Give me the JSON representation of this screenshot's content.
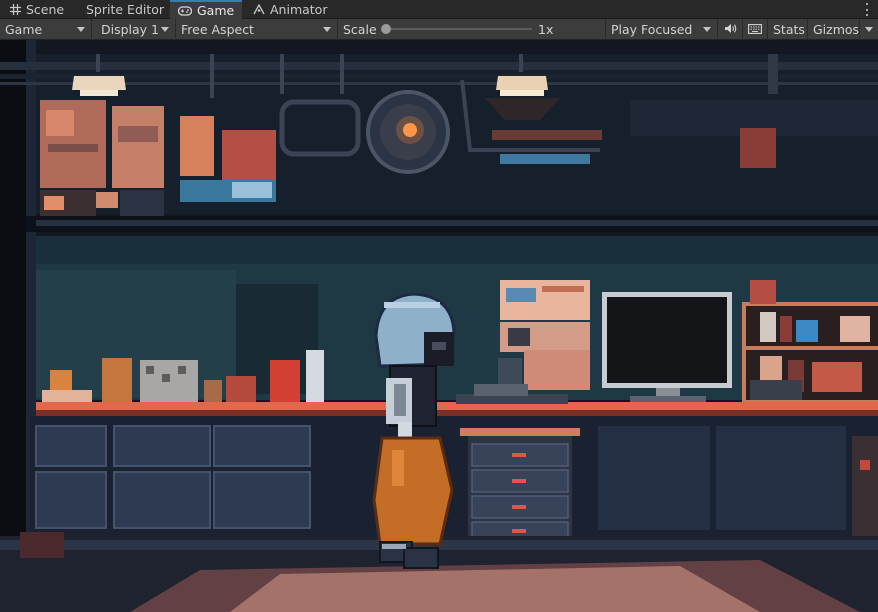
{
  "tabs": [
    {
      "label": "Scene",
      "icon": "grid-icon"
    },
    {
      "label": "Sprite Editor",
      "icon": ""
    },
    {
      "label": "Game",
      "icon": "gamepad-icon",
      "active": true
    },
    {
      "label": "Animator",
      "icon": "animator-icon"
    }
  ],
  "toolbar": {
    "mode": "Game",
    "display": "Display 1",
    "aspect": "Free Aspect",
    "scale_label": "Scale",
    "scale_value": "1x",
    "scale_fraction": 0.0,
    "play_mode": "Play Focused",
    "audio_icon": "speaker-icon",
    "aspect_icon": "keyboard-icon",
    "stats": "Stats",
    "gizmos": "Gizmos"
  },
  "colors": {
    "tab_accent": "#3a79bb",
    "toolbar_bg": "#3c3c3c",
    "tabbar_bg": "#282828"
  }
}
